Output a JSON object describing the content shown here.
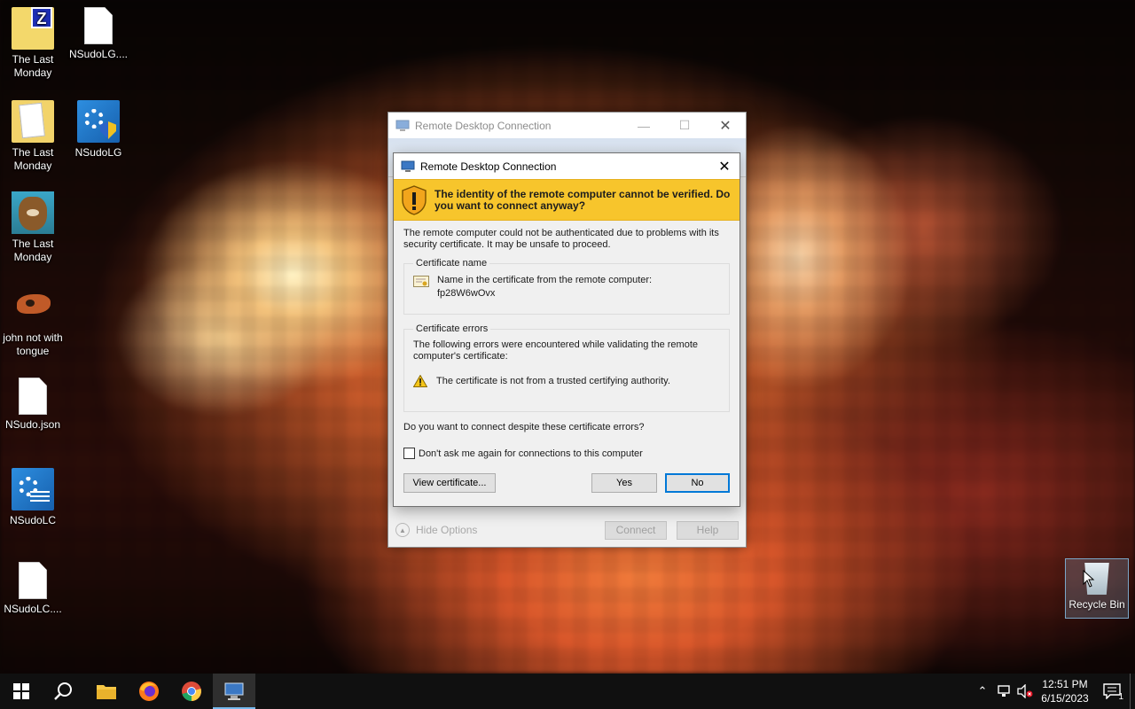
{
  "desktop": {
    "icons": [
      {
        "label": "The Last Monday",
        "icon": "zip-folder-icon"
      },
      {
        "label": "NSudoLG....",
        "icon": "document-icon"
      },
      {
        "label": "The Last Monday",
        "icon": "folder-document-icon"
      },
      {
        "label": "NSudoLG",
        "icon": "nsudo-gear-icon"
      },
      {
        "label": "The Last Monday",
        "icon": "cat-shortcut-icon"
      },
      {
        "label": "john not with tongue",
        "icon": "john-image-icon"
      },
      {
        "label": "NSudo.json",
        "icon": "document-icon"
      },
      {
        "label": "NSudoLC",
        "icon": "nsudo-console-icon"
      },
      {
        "label": "NSudoLC....",
        "icon": "document-icon"
      }
    ],
    "recycle_bin": "Recycle Bin"
  },
  "main_window": {
    "title": "Remote Desktop Connection",
    "hide_options": "Hide Options",
    "connect": "Connect",
    "help": "Help"
  },
  "dialog": {
    "title": "Remote Desktop Connection",
    "warning": "The identity of the remote computer cannot be verified. Do you want to connect anyway?",
    "description": "The remote computer could not be authenticated due to problems with its security certificate. It may be unsafe to proceed.",
    "cert_name_legend": "Certificate name",
    "cert_name_label": "Name in the certificate from the remote computer:",
    "cert_name_value": "fp28W6wOvx",
    "cert_errors_legend": "Certificate errors",
    "cert_errors_intro": "The following errors were encountered while validating the remote computer's certificate:",
    "cert_error_1": "The certificate is not from a trusted certifying authority.",
    "question": "Do you want to connect despite these certificate errors?",
    "dont_ask": "Don't ask me again for connections to this computer",
    "view_certificate": "View certificate...",
    "yes": "Yes",
    "no": "No",
    "banner_color": "#f7c52c"
  },
  "taskbar": {
    "apps": [
      "start-icon",
      "search-icon",
      "file-explorer-icon",
      "firefox-icon",
      "chrome-icon",
      "remote-desktop-icon"
    ],
    "time": "12:51 PM",
    "date": "6/15/2023",
    "notification_count": "1"
  }
}
